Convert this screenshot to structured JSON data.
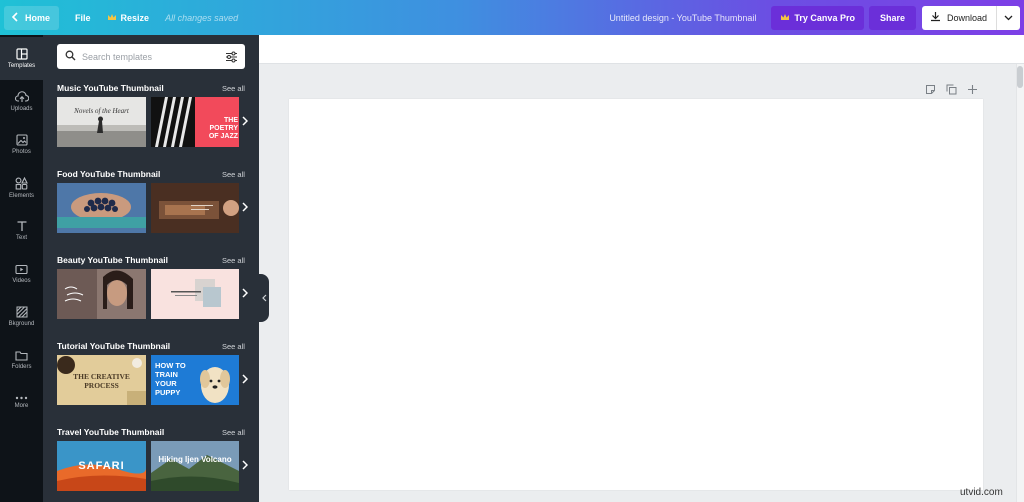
{
  "topbar": {
    "home_label": "Home",
    "file_label": "File",
    "resize_label": "Resize",
    "save_status": "All changes saved",
    "doc_title": "Untitled design - YouTube Thumbnail",
    "pro_label": "Try Canva Pro",
    "share_label": "Share",
    "download_label": "Download",
    "gradient": [
      "#1fc1d6",
      "#3f8fe0",
      "#7d3fe6"
    ],
    "pro_color": "#6b2fd9"
  },
  "rail": {
    "items": [
      {
        "label": "Templates",
        "icon": "templates-icon"
      },
      {
        "label": "Uploads",
        "icon": "upload-icon"
      },
      {
        "label": "Photos",
        "icon": "photo-icon"
      },
      {
        "label": "Elements",
        "icon": "elements-icon"
      },
      {
        "label": "Text",
        "icon": "text-icon"
      },
      {
        "label": "Videos",
        "icon": "video-icon"
      },
      {
        "label": "Bkground",
        "icon": "background-icon"
      },
      {
        "label": "Folders",
        "icon": "folder-icon"
      },
      {
        "label": "More",
        "icon": "more-icon"
      }
    ]
  },
  "search": {
    "placeholder": "Search templates",
    "value": ""
  },
  "sections": [
    {
      "title": "Music YouTube Thumbnail",
      "see_all": "See all",
      "thumbs": [
        {
          "text": "Novels of the Heart"
        },
        {
          "text": "THE POETRY OF JAZZ"
        }
      ]
    },
    {
      "title": "Food YouTube Thumbnail",
      "see_all": "See all",
      "thumbs": [
        {
          "text": ""
        },
        {
          "text": ""
        }
      ]
    },
    {
      "title": "Beauty YouTube Thumbnail",
      "see_all": "See all",
      "thumbs": [
        {
          "text": ""
        },
        {
          "text": ""
        }
      ]
    },
    {
      "title": "Tutorial YouTube Thumbnail",
      "see_all": "See all",
      "thumbs": [
        {
          "text": "THE CREATIVE PROCESS"
        },
        {
          "text": "HOW TO TRAIN YOUR PUPPY"
        }
      ]
    },
    {
      "title": "Travel YouTube Thumbnail",
      "see_all": "See all",
      "thumbs": [
        {
          "text": "SAFARI"
        },
        {
          "text": "Hiking Ijen Volcano"
        }
      ]
    }
  ],
  "watermark": "utvid.com"
}
